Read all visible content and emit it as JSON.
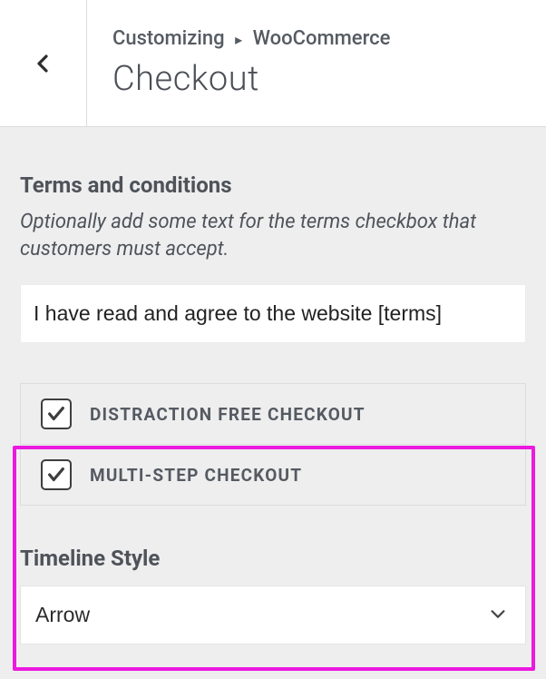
{
  "header": {
    "breadcrumb_prefix": "Customizing",
    "breadcrumb_current": "WooCommerce",
    "title": "Checkout"
  },
  "terms": {
    "heading": "Terms and conditions",
    "description": "Optionally add some text for the terms checkbox that customers must accept.",
    "input_value": "I have read and agree to the website [terms]"
  },
  "options": {
    "distraction_free": {
      "label": "DISTRACTION FREE CHECKOUT",
      "checked": true
    },
    "multi_step": {
      "label": "MULTI-STEP CHECKOUT",
      "checked": true
    }
  },
  "timeline": {
    "label": "Timeline Style",
    "value": "Arrow"
  }
}
